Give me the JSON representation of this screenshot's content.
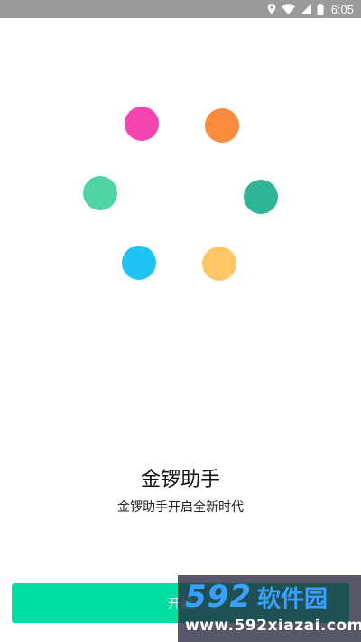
{
  "status_bar": {
    "time": "6:05",
    "background": "#9b9b9b",
    "icons": [
      "location-icon",
      "wifi-icon",
      "signal-icon",
      "battery-icon"
    ]
  },
  "loading_dots": [
    {
      "name": "pink-dot",
      "color": "#f545b0"
    },
    {
      "name": "orange-dot",
      "color": "#fa8a3c"
    },
    {
      "name": "teal-dot",
      "color": "#2fb596"
    },
    {
      "name": "yellow-dot",
      "color": "#fdc767"
    },
    {
      "name": "blue-dot",
      "color": "#1fc3f1"
    },
    {
      "name": "mint-dot",
      "color": "#50d4a3"
    }
  ],
  "splash": {
    "title": "金锣助手",
    "subtitle": "金锣助手开启全新时代"
  },
  "start_button": {
    "label": "开始",
    "color": "#00dea2"
  },
  "watermark": {
    "brand_number": "592",
    "brand_name": "软件园",
    "url": "www.592xiazai.com"
  }
}
